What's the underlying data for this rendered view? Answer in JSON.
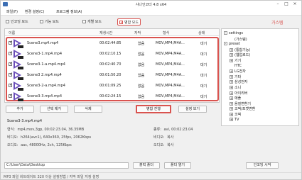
{
  "window": {
    "title": "샤나인코더 4.8 x64"
  },
  "menu": {
    "items": [
      "파일(F)",
      "환경 설정(C)",
      "프로그램 정보(A)"
    ]
  },
  "modes": {
    "items": [
      {
        "label": "인코딩 모드",
        "checked": false
      },
      {
        "label": "기능 모드",
        "checked": false
      },
      {
        "label": "개별 모드",
        "checked": false
      },
      {
        "label": "병합 모드",
        "checked": true
      }
    ]
  },
  "red_caption": "가스템",
  "list": {
    "columns": [
      "이름",
      "재생시간",
      "자막",
      "형식",
      "상태"
    ],
    "rows": [
      {
        "name": "Scene3.mp4.mp4",
        "duration": "00:02:44:85",
        "subtitle": "없음",
        "format": "MOV,MP4,M4A...",
        "status": "대기"
      },
      {
        "name": "Scene3-1.mp4.mp4",
        "duration": "00:02:10.15",
        "subtitle": "없음",
        "format": "MOV,MP4,M4A...",
        "status": "대기"
      },
      {
        "name": "Scene3-1-a.mp4.mp4",
        "duration": "00:02:40.70",
        "subtitle": "없음",
        "format": "MOV,MP4,M4A...",
        "status": "대기"
      },
      {
        "name": "Scene3 2.mp4.mp4",
        "duration": "00:01:50.20",
        "subtitle": "없음",
        "format": "MOV,MP4,M4A...",
        "status": "대기"
      },
      {
        "name": "Scene3-2-a.mp4.mp4",
        "duration": "00:01:09.25",
        "subtitle": "없음",
        "format": "MOV,MP4,M4A...",
        "status": "대기"
      },
      {
        "name": "Scene3-3.mp4.mp4",
        "duration": "00:02:24.15",
        "subtitle": "없음",
        "format": "MOV,MP4,M4A...",
        "status": "대기"
      }
    ]
  },
  "buttons": {
    "add": "추가",
    "remove_selected": "선택 제거",
    "clear": "삭제",
    "run": "병합 진행",
    "more": "설정 보기"
  },
  "tree": {
    "items": [
      {
        "label": "settings",
        "level": 0,
        "expander": "-"
      },
      {
        "label": "(가스템)",
        "level": 1,
        "expander": ""
      },
      {
        "label": "preset",
        "level": 0,
        "expander": "-"
      },
      {
        "label": "(통합기능)",
        "level": 1,
        "expander": "+"
      },
      {
        "label": "(웹업로드)",
        "level": 1,
        "expander": "+"
      },
      {
        "label": "기기",
        "level": 1,
        "expander": "+"
      },
      {
        "label": "HTC",
        "level": 1,
        "expander": ""
      },
      {
        "label": "LG전자",
        "level": 1,
        "expander": "+"
      },
      {
        "label": "기타",
        "level": 1,
        "expander": "+"
      },
      {
        "label": "삼성전자",
        "level": 1,
        "expander": "+"
      },
      {
        "label": "소니",
        "level": 1,
        "expander": "+"
      },
      {
        "label": "아이리버",
        "level": 1,
        "expander": "+"
      },
      {
        "label": "애플",
        "level": 1,
        "expander": "+"
      },
      {
        "label": "음질변환기",
        "level": 1,
        "expander": "+"
      },
      {
        "label": "코덱/포맷변환",
        "level": 1,
        "expander": "+"
      },
      {
        "label": "코덱",
        "level": 1,
        "expander": "+"
      },
      {
        "label": "TV",
        "level": 1,
        "expander": "+"
      }
    ]
  },
  "info": {
    "title": "Scene3-3.mp4.mp4",
    "rows": [
      {
        "key": "형식",
        "value": "mp4,mov,3gp, 00:02:23.04, 36.35MB",
        "key2": "종류",
        "value2": "avi, 00:02:23.04"
      },
      {
        "key": "비디오",
        "value": "h264(avc1), 640x360, 25fps, 2062Kbps",
        "key2": "비디오",
        "value2": "복사"
      },
      {
        "key": "오디오",
        "value": "aac, 48000Hz, 2ch, 125Kbps",
        "key2": "오디오",
        "value2": "복사"
      }
    ]
  },
  "output": {
    "path": "C:\\User\\Data\\Desktop",
    "browse_label": "출력 폴더",
    "open_label": "폴더 열기",
    "convert_label": "인코딩 시작"
  },
  "status": {
    "text": "MP3 파일 비트레이트 320 이상 설정방법 / 자막 파일 지정 설명"
  }
}
